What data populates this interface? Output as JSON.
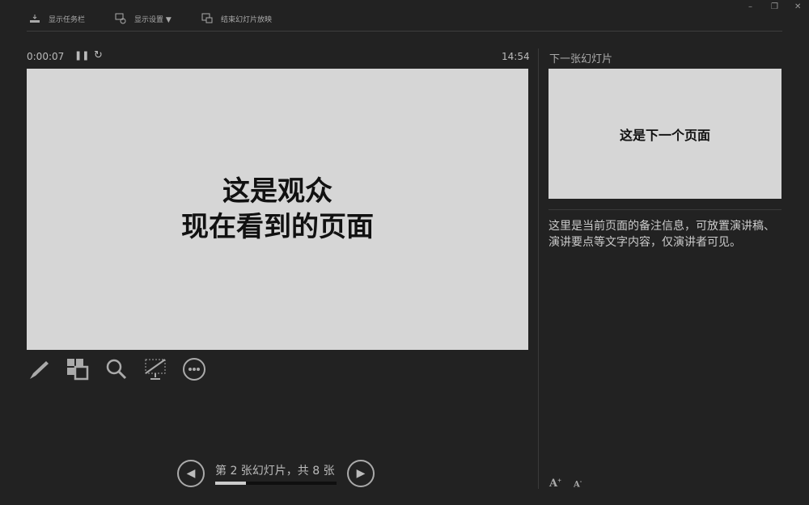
{
  "toolbar": {
    "taskbar": "显示任务栏",
    "display_settings": "显示设置 ▼",
    "end_show": "结束幻灯片放映"
  },
  "window": {
    "minimize": "–",
    "restore": "❐",
    "close": "✕"
  },
  "timer": {
    "elapsed": "0:00:07",
    "clock": "14:54"
  },
  "current_slide": {
    "line1": "这是观众",
    "line2": "现在看到的页面"
  },
  "next_slide": {
    "label": "下一张幻灯片",
    "text": "这是下一个页面"
  },
  "notes": {
    "text": "这里是当前页面的备注信息，可放置演讲稿、演讲要点等文字内容，仅演讲者可见。"
  },
  "navigation": {
    "counter": "第 2 张幻灯片，共 8 张",
    "current": 2,
    "total": 8,
    "progress": 0.25
  },
  "font_controls": {
    "increase": "A",
    "decrease": "A"
  }
}
